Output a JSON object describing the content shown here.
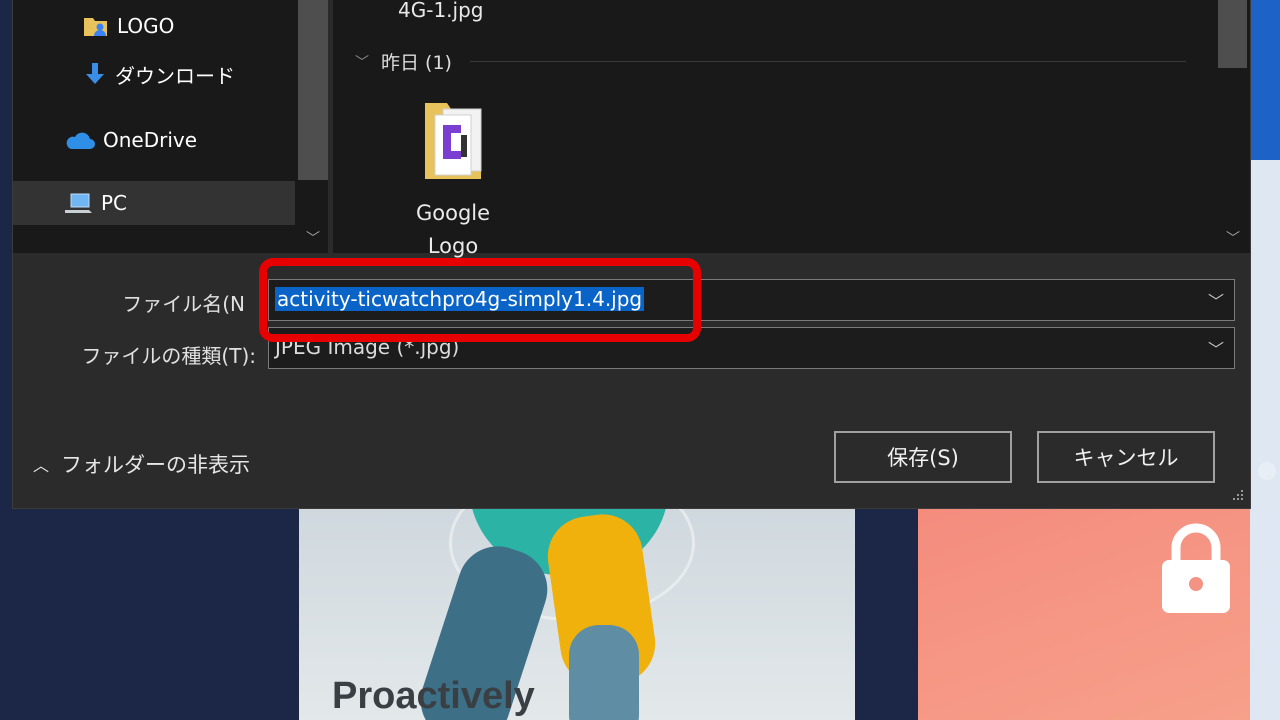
{
  "background": {
    "headline": "Proactively"
  },
  "nav": {
    "items": [
      {
        "label": "LOGO",
        "icon": "folder-user-icon"
      },
      {
        "label": "ダウンロード",
        "icon": "download-arrow-icon"
      },
      {
        "label": "OneDrive",
        "icon": "cloud-icon"
      },
      {
        "label": "PC",
        "icon": "computer-icon"
      }
    ],
    "selected": "PC"
  },
  "content": {
    "previous_item_name": "4G-1.jpg",
    "group_label": "昨日 (1)",
    "file": {
      "name_line1": "Google",
      "name_line2": "Logo",
      "icon": "folder-icon"
    }
  },
  "form": {
    "filename_label": "ファイル名(N",
    "filename_value": "activity-ticwatchpro4g-simply1.4.jpg",
    "filetype_label": "ファイルの種類(T):",
    "filetype_value": "JPEG Image (*.jpg)"
  },
  "footer": {
    "toggle_label": "フォルダーの非表示",
    "save_label": "保存(S)",
    "cancel_label": "キャンセル"
  },
  "colors": {
    "highlight": "#0a64c8",
    "annotation_red": "#e60000",
    "dialog_bg": "#2b2b2b"
  }
}
